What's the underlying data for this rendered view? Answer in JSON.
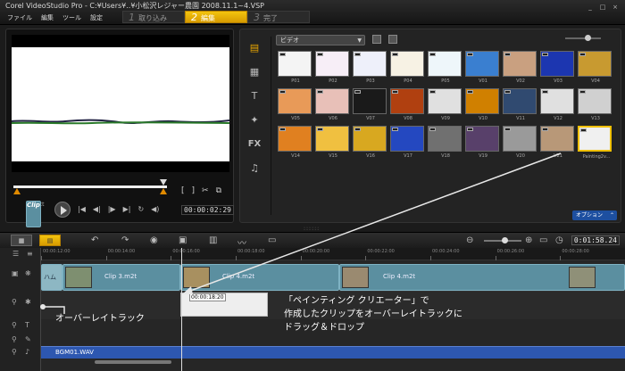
{
  "window": {
    "title": "Corel VideoStudio Pro - C:¥Users¥..¥小松沢レジャー農園 2008.11.1~4.VSP",
    "menu": [
      "ファイル",
      "編集",
      "ツール",
      "設定"
    ],
    "steps": [
      {
        "num": "1",
        "label": "取り込み",
        "active": false
      },
      {
        "num": "2",
        "label": "編集",
        "active": true
      },
      {
        "num": "3",
        "label": "完了",
        "active": false
      }
    ],
    "controls": [
      "_",
      "□",
      "×"
    ]
  },
  "preview": {
    "project_label": "Project",
    "clip_label": "Clip",
    "timecode": "00:00:02:29",
    "mark_in": "[",
    "mark_out": "]",
    "transport": [
      "|◀",
      "◀|",
      "|▶",
      "▶|",
      "↻",
      "◀)"
    ]
  },
  "library": {
    "category": "ビデオ",
    "tabs": [
      "media-icon",
      "instant-project-icon",
      "title-icon",
      "graphics-icon",
      "FX",
      "audio-icon"
    ],
    "thumbnails": [
      {
        "label": "P01",
        "color": "#f4f4f4"
      },
      {
        "label": "P02",
        "color": "#f7eef7"
      },
      {
        "label": "P03",
        "color": "#eef0fa"
      },
      {
        "label": "P04",
        "color": "#f7f2e4"
      },
      {
        "label": "P05",
        "color": "#eef6fa"
      },
      {
        "label": "V01",
        "color": "#3a7fd0"
      },
      {
        "label": "V02",
        "color": "#c9a080"
      },
      {
        "label": "V03",
        "color": "#1c36b0"
      },
      {
        "label": "V04",
        "color": "#c89a30"
      },
      {
        "label": "V05",
        "color": "#e89a58"
      },
      {
        "label": "V06",
        "color": "#e8c0b8"
      },
      {
        "label": "V07",
        "color": "#1a1a1a"
      },
      {
        "label": "V08",
        "color": "#b04010"
      },
      {
        "label": "V09",
        "color": "#e0e0e0"
      },
      {
        "label": "V10",
        "color": "#d08000"
      },
      {
        "label": "V11",
        "color": "#304a70"
      },
      {
        "label": "V12",
        "color": "#e0e0e0"
      },
      {
        "label": "V13",
        "color": "#d0d0d0"
      },
      {
        "label": "V14",
        "color": "#e08020"
      },
      {
        "label": "V15",
        "color": "#f0c040"
      },
      {
        "label": "V16",
        "color": "#d8a820"
      },
      {
        "label": "V17",
        "color": "#2448c0"
      },
      {
        "label": "V18",
        "color": "#707070"
      },
      {
        "label": "V19",
        "color": "#58406a"
      },
      {
        "label": "V20",
        "color": "#9a9a9a"
      },
      {
        "label": "V21",
        "color": "#b89878"
      },
      {
        "label": "Painting2v...",
        "color": "#f0f0f0"
      }
    ],
    "options_button": "オプション"
  },
  "timeline": {
    "timecode": "0:01:58.24",
    "ruler": [
      "00:00:12:00",
      "00:00:14:00",
      "00:00:16:00",
      "00:00:18:00",
      "00:00:20:00",
      "00:00:22:00",
      "00:00:24:00",
      "00:00:26:00",
      "00:00:28:00"
    ],
    "clips": [
      {
        "name": "ハム"
      },
      {
        "name": "Clip 3.m2t"
      },
      {
        "name": "Clip 4.m2t"
      },
      {
        "name": "Clip 4.m2t"
      }
    ],
    "drag_timecode": "00:00:18:20",
    "audio_clip": "BGM01.WAV"
  },
  "annotations": {
    "overlay_track_label": "オーバーレイトラック",
    "instruction_lines": [
      "「ペインティング クリエーター」で",
      "作成したクリップをオーバーレイトラックに",
      "ドラッグ＆ドロップ"
    ]
  }
}
